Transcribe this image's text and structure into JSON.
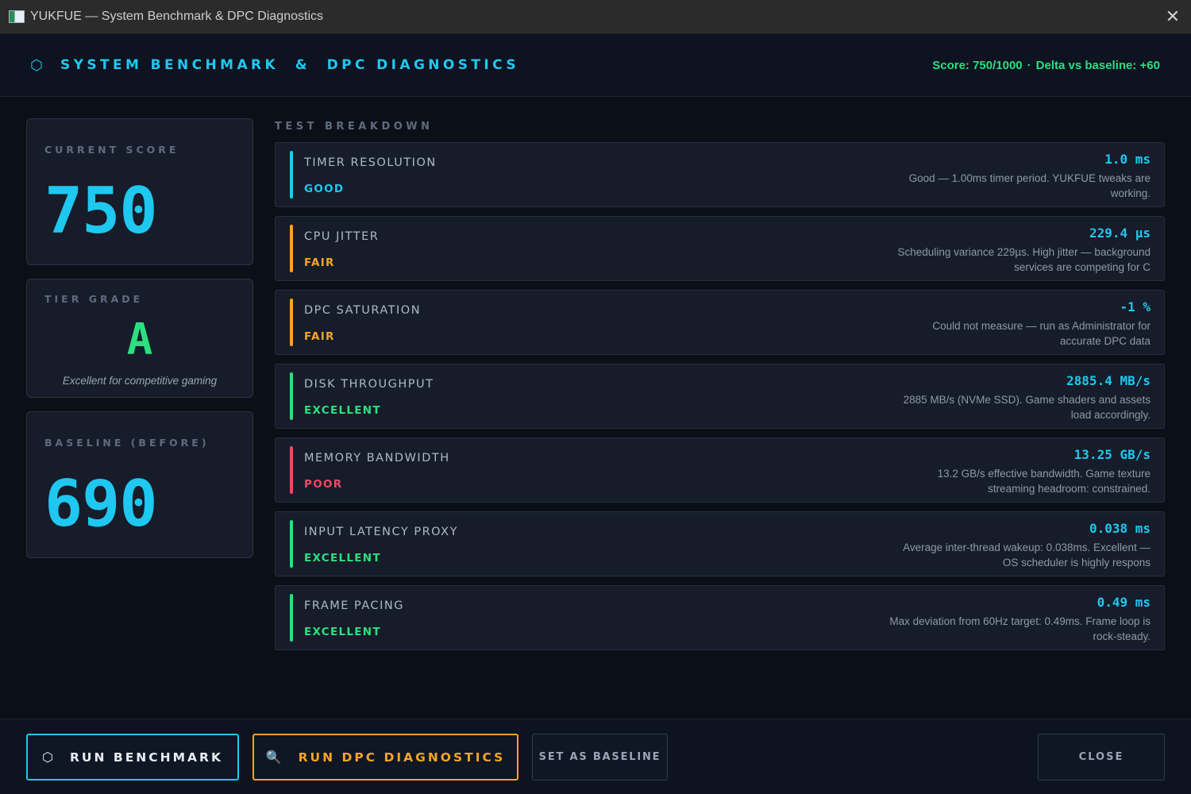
{
  "window": {
    "title": "YUKFUE — System Benchmark & DPC Diagnostics",
    "close_glyph": "✕"
  },
  "header": {
    "icon": "⬡",
    "title": "SYSTEM BENCHMARK  &  DPC DIAGNOSTICS",
    "score_text": "Score: 750/1000",
    "separator": "·",
    "delta_text": "Delta vs baseline: +60"
  },
  "current_score": {
    "label": "CURRENT SCORE",
    "value": "750"
  },
  "tier": {
    "label": "TIER GRADE",
    "grade": "A",
    "description": "Excellent for competitive gaming"
  },
  "baseline": {
    "label": "BASELINE (BEFORE)",
    "value": "690"
  },
  "breakdown": {
    "label": "TEST BREAKDOWN",
    "tests": [
      {
        "name": "TIMER RESOLUTION",
        "status": "GOOD",
        "value": "1.0 ms",
        "desc": "Good — 1.00ms timer period. YUKFUE tweaks are working."
      },
      {
        "name": "CPU JITTER",
        "status": "FAIR",
        "value": "229.4 µs",
        "desc": "Scheduling variance 229µs. High jitter — background services are competing for C"
      },
      {
        "name": "DPC SATURATION",
        "status": "FAIR",
        "value": "-1 %",
        "desc": "Could not measure — run as Administrator for accurate DPC data"
      },
      {
        "name": "DISK THROUGHPUT",
        "status": "EXCELLENT",
        "value": "2885.4 MB/s",
        "desc": "2885 MB/s (NVMe SSD). Game shaders and assets load accordingly."
      },
      {
        "name": "MEMORY BANDWIDTH",
        "status": "POOR",
        "value": "13.25 GB/s",
        "desc": "13.2 GB/s effective bandwidth. Game texture streaming headroom: constrained."
      },
      {
        "name": "INPUT LATENCY PROXY",
        "status": "EXCELLENT",
        "value": "0.038 ms",
        "desc": "Average inter-thread wakeup: 0.038ms. Excellent — OS scheduler is highly respons"
      },
      {
        "name": "FRAME PACING",
        "status": "EXCELLENT",
        "value": "0.49 ms",
        "desc": "Max deviation from 60Hz target: 0.49ms. Frame loop is rock-steady."
      }
    ]
  },
  "status_colors": {
    "GOOD": "#1fc8f0",
    "FAIR": "#f5a524",
    "EXCELLENT": "#2be07f",
    "POOR": "#f04862"
  },
  "footer": {
    "run_icon": "⬡",
    "run_label": "RUN BENCHMARK",
    "dpc_icon": "🔍",
    "dpc_label": "RUN DPC DIAGNOSTICS",
    "baseline_label": "SET AS BASELINE",
    "close_label": "CLOSE"
  }
}
